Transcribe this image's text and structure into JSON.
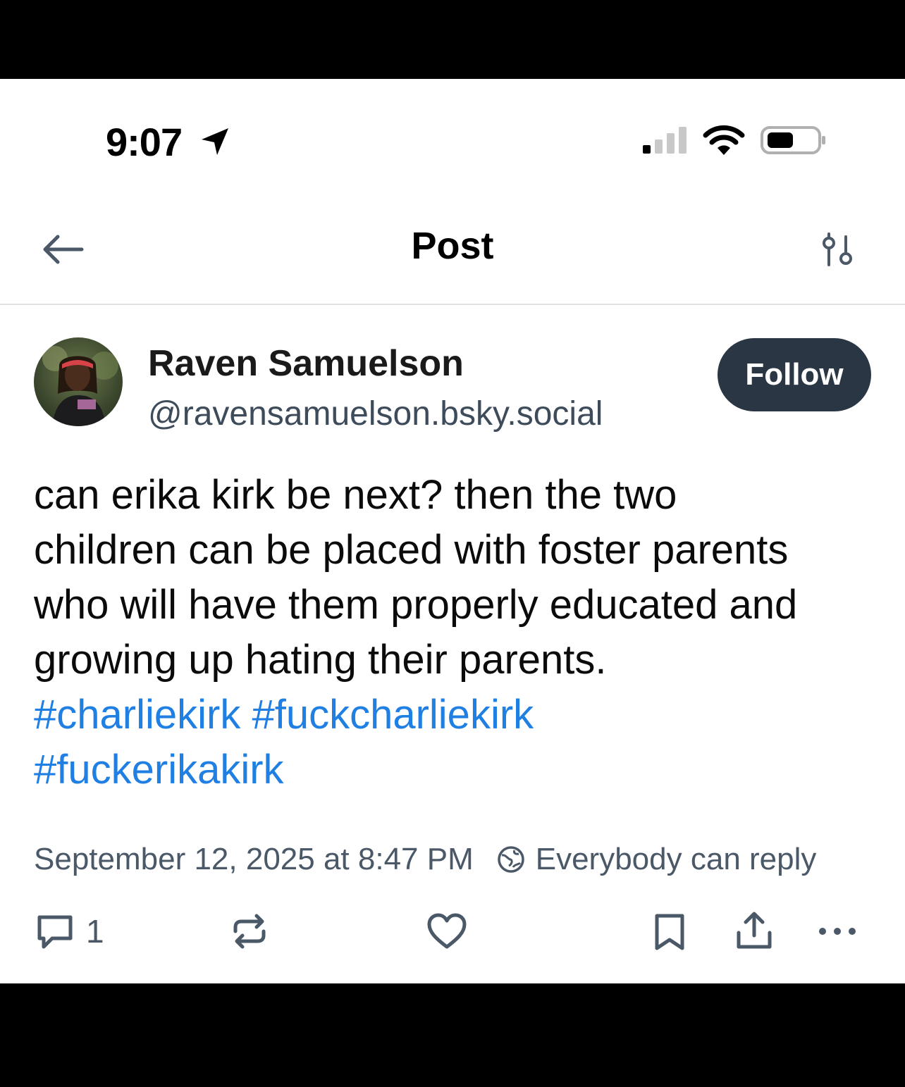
{
  "status_bar": {
    "time": "9:07"
  },
  "header": {
    "title": "Post"
  },
  "author": {
    "display_name": "Raven Samuelson",
    "handle": "@ravensamuelson.bsky.social",
    "follow_label": "Follow"
  },
  "post": {
    "text_lines": [
      "can erika kirk be next? then the two",
      "children can be placed with foster parents",
      "who will have them properly educated and",
      "growing up hating their parents."
    ],
    "hashtags": [
      "#charliekirk",
      "#fuckcharliekirk",
      "#fuckerikakirk"
    ],
    "timestamp": "September 12, 2025 at 8:47 PM",
    "reply_setting": "Everybody can reply"
  },
  "actions": {
    "reply_count": "1"
  },
  "colors": {
    "link": "#1f7fe3",
    "follow_bg": "#2b3645",
    "muted_text": "#4a5867"
  },
  "icons": [
    "location-arrow-icon",
    "signal-icon",
    "wifi-icon",
    "battery-icon",
    "back-arrow-icon",
    "filter-icon",
    "globe-icon",
    "reply-icon",
    "repost-icon",
    "like-icon",
    "bookmark-icon",
    "share-icon",
    "more-icon"
  ]
}
